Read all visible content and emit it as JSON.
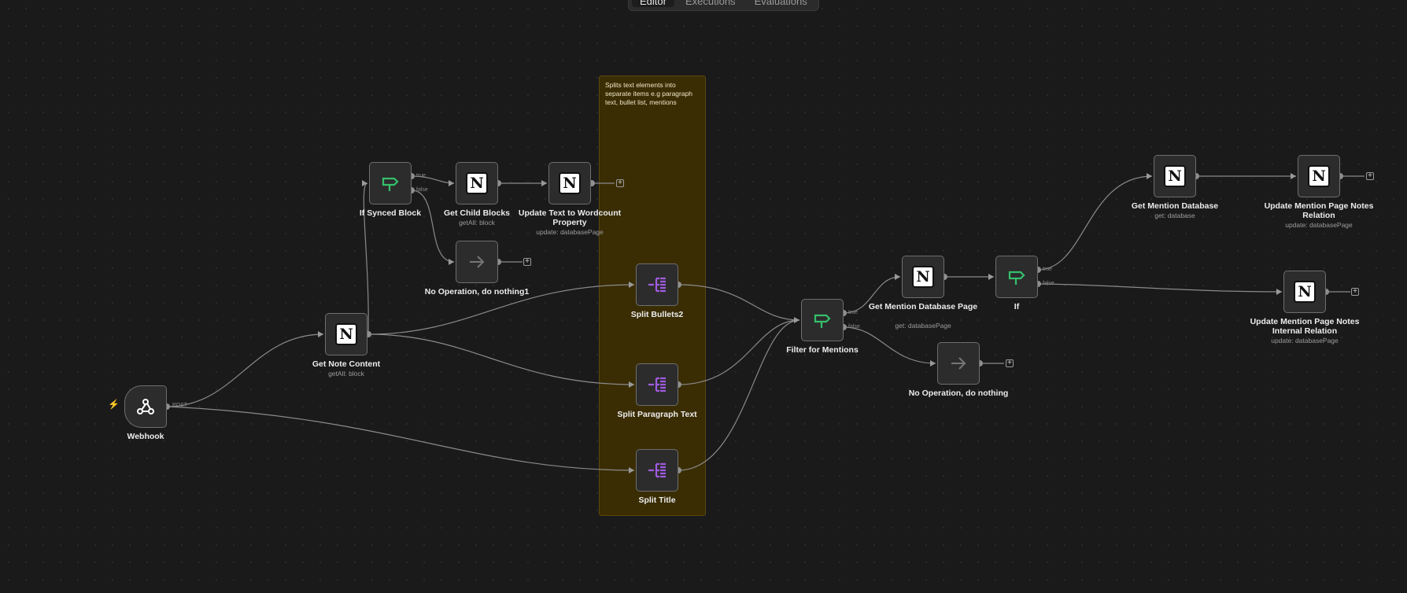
{
  "tabs": [
    {
      "label": "Editor",
      "active": true
    },
    {
      "label": "Executions",
      "active": false
    },
    {
      "label": "Evaluations",
      "active": false
    }
  ],
  "sticky": {
    "text": "Splits text elements into separate items e.g paragraph text, bullet list, mentions"
  },
  "port_labels": {
    "true": "true",
    "false": "false",
    "post": "POST"
  },
  "colors": {
    "if_icon": "#35c06b",
    "split_icon": "#a05be0",
    "trigger_bolt": "#ff6d3a",
    "sticky_bg": "#3a2d04"
  },
  "nodes": {
    "webhook": {
      "label": "Webhook",
      "icon": "webhook-icon"
    },
    "get_note_content": {
      "label": "Get Note Content",
      "sub": "getAll: block",
      "icon": "notion-icon"
    },
    "if_synced_block": {
      "label": "If Synced Block",
      "icon": "if-icon"
    },
    "get_child_blocks": {
      "label": "Get Child Blocks",
      "sub": "getAll: block",
      "icon": "notion-icon"
    },
    "update_text": {
      "label": "Update Text to Wordcount Property",
      "sub": "update: databasePage",
      "icon": "notion-icon"
    },
    "no_op_1": {
      "label": "No Operation, do nothing1",
      "icon": "arrow-right-icon"
    },
    "split_bullets": {
      "label": "Split Bullets2",
      "icon": "split-icon"
    },
    "split_paragraph": {
      "label": "Split Paragraph Text",
      "icon": "split-icon"
    },
    "split_title": {
      "label": "Split Title",
      "icon": "split-icon"
    },
    "filter_mentions": {
      "label": "Filter for Mentions",
      "icon": "if-icon"
    },
    "get_mention_db_page": {
      "label": "Get Mention Database Page",
      "sub": "get: databasePage",
      "icon": "notion-icon"
    },
    "if_node": {
      "label": "If",
      "icon": "if-icon"
    },
    "no_op": {
      "label": "No Operation, do nothing",
      "icon": "arrow-right-icon"
    },
    "get_mention_db": {
      "label": "Get Mention Database",
      "sub": "get: database",
      "icon": "notion-icon"
    },
    "update_notes_relation": {
      "label": "Update Mention Page Notes Relation",
      "sub": "update: databasePage",
      "icon": "notion-icon"
    },
    "update_internal_relation": {
      "label": "Update Mention Page Notes Internal Relation",
      "sub": "update: databasePage",
      "icon": "notion-icon"
    }
  }
}
